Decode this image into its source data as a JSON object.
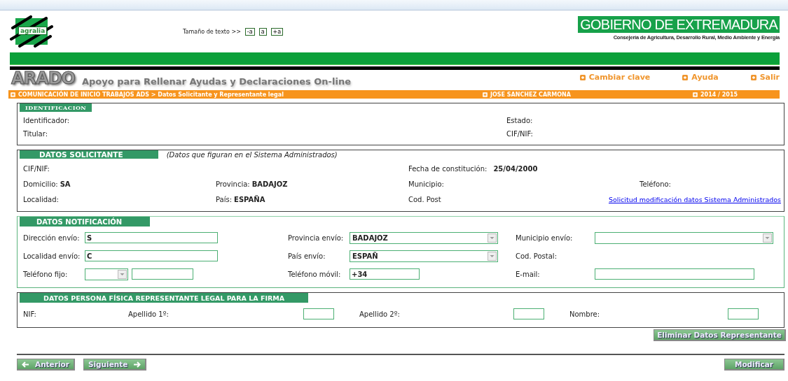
{
  "header": {
    "logo_text": "agralia",
    "text_size_label": "Tamaño de texto >>",
    "text_size_buttons": [
      "-a",
      "a",
      "+a"
    ],
    "gov_title": "GOBIERNO DE EXTREMADURA",
    "gov_subtitle": "Consejería de Agricultura, Desarrollo Rural, Medio Ambiente y Energía"
  },
  "app": {
    "name": "ARADO",
    "tagline": "Apoyo para Rellenar Ayudas y Declaraciones On-line",
    "links": [
      "Cambiar clave",
      "Ayuda",
      "Salir"
    ]
  },
  "breadcrumb_bar": {
    "path": "COMUNICACIÓN DE INICIO TRABAJOS ADS > Datos Solicitante y Representante legal",
    "user": "JOSE SANCHEZ CARMONA",
    "campaign": "2014 / 2015"
  },
  "sections": [
    {
      "kind": "identification",
      "title": "IDENTIFICACION",
      "rows": [
        [
          {
            "kind": "text",
            "label": "Identificador:"
          },
          {
            "kind": "text",
            "label": "Estado:"
          }
        ],
        [
          {
            "kind": "text",
            "label": "Titular:"
          },
          {
            "kind": "text",
            "label": "CIF/NIF:"
          }
        ]
      ]
    },
    {
      "kind": "applicant",
      "title": "DATOS SOLICITANTE",
      "note": "(Datos que figuran en el Sistema Administrados)",
      "rows": [
        [
          {
            "kind": "text",
            "label": "CIF/NIF:"
          },
          "",
          {
            "kind": "text",
            "label": "Fecha de constitución:",
            "value": "25/04/2000"
          }
        ],
        [
          {
            "kind": "text",
            "label": "Domicilio:",
            "value": "SA"
          },
          {
            "kind": "text",
            "label": "Provincia:",
            "value": "BADAJOZ"
          },
          {
            "kind": "text",
            "label": "Municipio:"
          },
          {
            "kind": "text",
            "label": "Teléfono:"
          }
        ],
        [
          {
            "kind": "text",
            "label": "Localidad:"
          },
          {
            "kind": "text",
            "label": "País:",
            "value": "ESPAÑA"
          },
          {
            "kind": "text",
            "label": "Cod. Post"
          },
          {
            "kind": "link",
            "text": "Solicitud modificación datos Sistema Administrados"
          }
        ]
      ]
    },
    {
      "kind": "notification",
      "title": "DATOS NOTIFICACIÓN",
      "rows": [
        [
          {
            "kind": "input",
            "label": "Dirección envío:",
            "value": "S"
          },
          {
            "kind": "select",
            "label": "Provincia envío:",
            "value": "BADAJOZ"
          },
          {
            "kind": "select",
            "label": "Municipio envío:"
          }
        ],
        [
          {
            "kind": "input",
            "label": "Localidad envío:",
            "value": "C"
          },
          {
            "kind": "select",
            "label": "País envío:",
            "value": "ESPAÑ"
          },
          {
            "kind": "text",
            "label": "Cod. Postal:"
          }
        ],
        [
          {
            "kind": "phone",
            "label": "Teléfono fijo:"
          },
          {
            "kind": "input",
            "label": "Teléfono móvil:",
            "value": "+34"
          },
          {
            "kind": "input",
            "label": "E-mail:"
          }
        ]
      ]
    },
    {
      "kind": "representative",
      "title": "DATOS PERSONA FÍSICA REPRESENTANTE LEGAL PARA LA FIRMA",
      "rows": [
        [
          {
            "kind": "text",
            "label": "NIF:"
          },
          {
            "kind": "input",
            "label": "Apellido 1º:"
          },
          {
            "kind": "input",
            "label": "Apellido 2º:"
          },
          {
            "kind": "input",
            "label": "Nombre:"
          }
        ]
      ],
      "button": "Eliminar Datos Representante"
    }
  ],
  "footer": {
    "previous": "Anterior",
    "next": "Siguiente",
    "modify": "Modificar"
  }
}
